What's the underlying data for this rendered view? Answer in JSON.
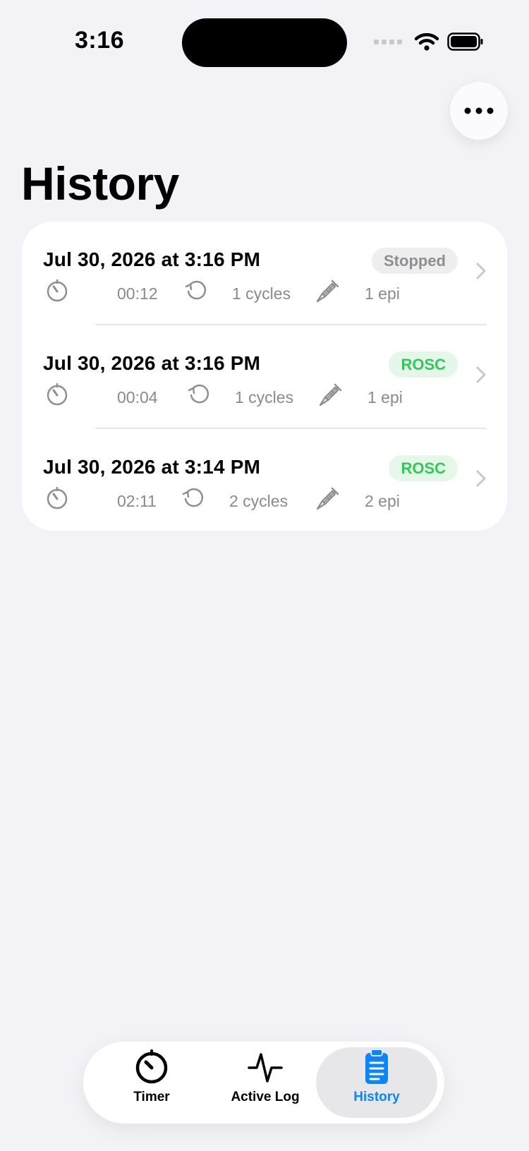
{
  "status_bar": {
    "time": "3:16"
  },
  "header": {
    "title": "History",
    "more_icon": "ellipsis-icon"
  },
  "sessions": [
    {
      "title": "Jul 30, 2026 at 3:16 PM",
      "status": "Stopped",
      "duration": "00:12",
      "cycles": "1 cycles",
      "epi": "1 epi"
    },
    {
      "title": "Jul 30, 2026 at 3:16 PM",
      "status": "ROSC",
      "duration": "00:04",
      "cycles": "1 cycles",
      "epi": "1 epi"
    },
    {
      "title": "Jul 30, 2026 at 3:14 PM",
      "status": "ROSC",
      "duration": "02:11",
      "cycles": "2 cycles",
      "epi": "2 epi"
    }
  ],
  "tabbar": {
    "tabs": [
      {
        "label": "Timer",
        "icon": "timer-icon"
      },
      {
        "label": "Active Log",
        "icon": "waveform-icon"
      },
      {
        "label": "History",
        "icon": "clipboard-icon",
        "active": true
      }
    ]
  },
  "colors": {
    "accent": "#0a84ff",
    "rosc": "#34c759",
    "stopped": "#8e8e93",
    "background": "#f2f2f7"
  }
}
